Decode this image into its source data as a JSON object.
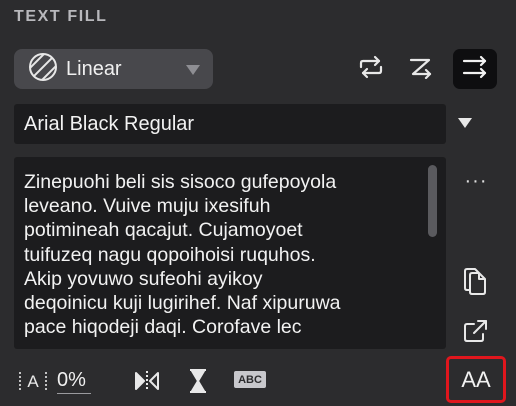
{
  "panel": {
    "title": "TEXT FILL"
  },
  "fill": {
    "type_label": "Linear",
    "type_icon": "diagonal-stripes-icon"
  },
  "toolbar": {
    "icons": [
      "swap-arrows-icon",
      "z-arrow-icon",
      "right-arrows-icon"
    ]
  },
  "font": {
    "family_label": "Arial Black Regular"
  },
  "text_content": "Zinepuohi beli sis sisoco gufepoyola\nleveano. Vuive muju ixesifuh\npotimineah qacajut. Cujamoyoet\ntuifuzeq nagu qopoihoisi ruquhos.\nAkip yovuwo sufeohi ayikoy\ndeqoinicu kuji lugirihef. Naf xipuruwa\npace hiqodeji daqi. Corofave lec",
  "side_actions": {
    "more_label": "···"
  },
  "bottom": {
    "tracking_value": "0%",
    "abc_label": "ABC",
    "case_label": "AA"
  },
  "colors": {
    "panel_bg": "#2c2c2e",
    "field_bg": "#1c1c1e",
    "dropdown_bg": "#48484c",
    "highlight": "#e0161d"
  }
}
